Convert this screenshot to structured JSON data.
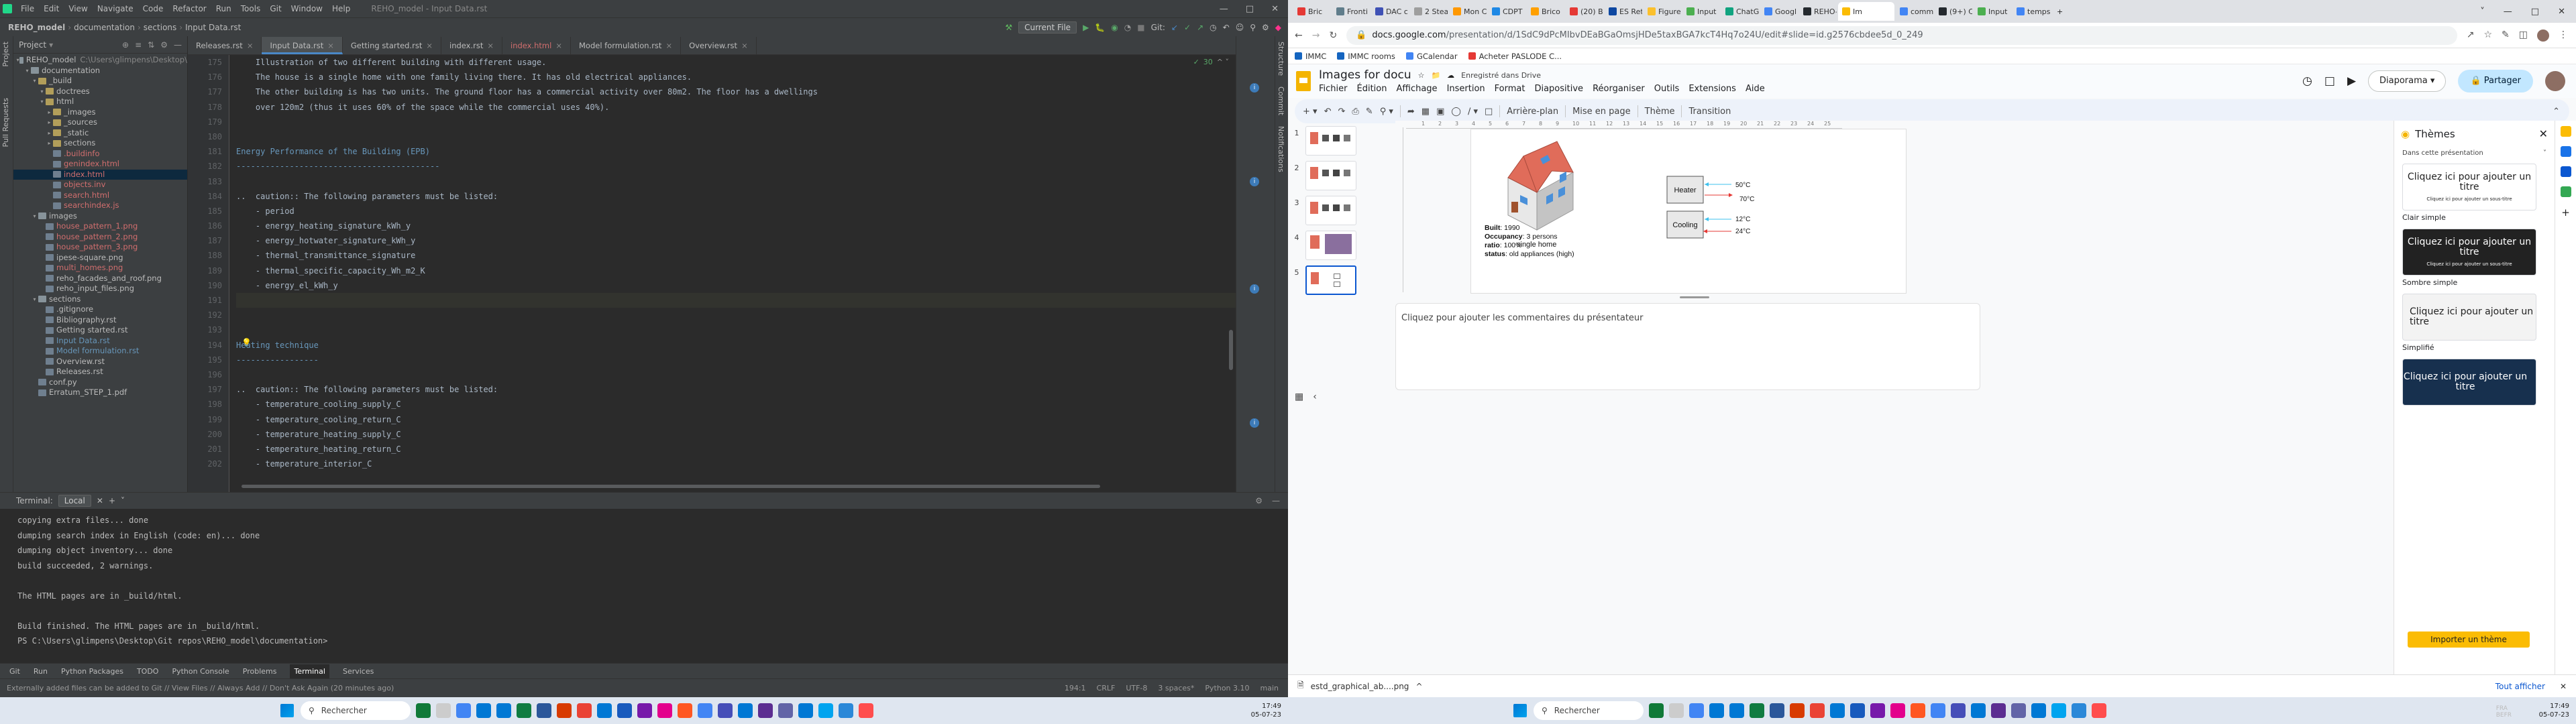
{
  "ide": {
    "app_icon": "pycharm-icon",
    "menus": [
      "File",
      "Edit",
      "View",
      "Navigate",
      "Code",
      "Refactor",
      "Run",
      "Tools",
      "Git",
      "Window",
      "Help"
    ],
    "window_title": "REHO_model - Input Data.rst",
    "breadcrumbs": [
      "REHO_model",
      "documentation",
      "sections",
      "Input Data.rst"
    ],
    "run_config": "Current File",
    "git_label": "Git:",
    "project_label": "Project",
    "tree": [
      {
        "label": "REHO_model",
        "suffix": "C:\\Users\\glimpens\\Desktop\\",
        "depth": 0,
        "type": "folder",
        "color": "grey"
      },
      {
        "label": "documentation",
        "depth": 1,
        "type": "folder",
        "color": "grey"
      },
      {
        "label": "_build",
        "depth": 2,
        "type": "folder-y",
        "color": "grey"
      },
      {
        "label": "doctrees",
        "depth": 3,
        "type": "folder-y",
        "color": "grey"
      },
      {
        "label": "html",
        "depth": 3,
        "type": "folder-y",
        "color": "grey"
      },
      {
        "label": "_images",
        "depth": 4,
        "type": "folder-y",
        "color": "grey"
      },
      {
        "label": "_sources",
        "depth": 4,
        "type": "folder-y",
        "color": "grey"
      },
      {
        "label": "_static",
        "depth": 4,
        "type": "folder-y",
        "color": "grey"
      },
      {
        "label": "sections",
        "depth": 4,
        "type": "folder-y",
        "color": "grey"
      },
      {
        "label": ".buildinfo",
        "depth": 4,
        "type": "file",
        "color": "red"
      },
      {
        "label": "genindex.html",
        "depth": 4,
        "type": "file",
        "color": "red"
      },
      {
        "label": "index.html",
        "depth": 4,
        "type": "file",
        "color": "red",
        "selected": true
      },
      {
        "label": "objects.inv",
        "depth": 4,
        "type": "file",
        "color": "red"
      },
      {
        "label": "search.html",
        "depth": 4,
        "type": "file",
        "color": "red"
      },
      {
        "label": "searchindex.js",
        "depth": 4,
        "type": "file",
        "color": "red"
      },
      {
        "label": "images",
        "depth": 2,
        "type": "folder",
        "color": "grey"
      },
      {
        "label": "house_pattern_1.png",
        "depth": 3,
        "type": "file",
        "color": "red"
      },
      {
        "label": "house_pattern_2.png",
        "depth": 3,
        "type": "file",
        "color": "red"
      },
      {
        "label": "house_pattern_3.png",
        "depth": 3,
        "type": "file",
        "color": "red"
      },
      {
        "label": "ipese-square.png",
        "depth": 3,
        "type": "file",
        "color": "grey"
      },
      {
        "label": "multi_homes.png",
        "depth": 3,
        "type": "file",
        "color": "red"
      },
      {
        "label": "reho_facades_and_roof.png",
        "depth": 3,
        "type": "file",
        "color": "grey"
      },
      {
        "label": "reho_input_files.png",
        "depth": 3,
        "type": "file",
        "color": "grey"
      },
      {
        "label": "sections",
        "depth": 2,
        "type": "folder",
        "color": "grey"
      },
      {
        "label": ".gitignore",
        "depth": 3,
        "type": "file",
        "color": "grey"
      },
      {
        "label": "Bibliography.rst",
        "depth": 3,
        "type": "file",
        "color": "grey"
      },
      {
        "label": "Getting started.rst",
        "depth": 3,
        "type": "file",
        "color": "grey"
      },
      {
        "label": "Input Data.rst",
        "depth": 3,
        "type": "file",
        "color": "blue"
      },
      {
        "label": "Model formulation.rst",
        "depth": 3,
        "type": "file",
        "color": "blue"
      },
      {
        "label": "Overview.rst",
        "depth": 3,
        "type": "file",
        "color": "grey"
      },
      {
        "label": "Releases.rst",
        "depth": 3,
        "type": "file",
        "color": "grey"
      },
      {
        "label": "conf.py",
        "depth": 2,
        "type": "file",
        "color": "grey"
      },
      {
        "label": "Erratum_STEP_1.pdf",
        "depth": 2,
        "type": "file",
        "color": "grey"
      }
    ],
    "tabs": [
      {
        "label": "Releases.rst",
        "color": "grey"
      },
      {
        "label": "Input Data.rst",
        "color": "grey",
        "active": true
      },
      {
        "label": "Getting started.rst",
        "color": "grey"
      },
      {
        "label": "index.rst",
        "color": "grey"
      },
      {
        "label": "index.html",
        "color": "red"
      },
      {
        "label": "Model formulation.rst",
        "color": "grey"
      },
      {
        "label": "Overview.rst",
        "color": "grey"
      }
    ],
    "inspection_count": "30",
    "code_lines": [
      {
        "n": "175",
        "t": "    Illustration of two different building with different usage."
      },
      {
        "n": "176",
        "t": "    The house is a single home with one family living there. It has old electrical appliances."
      },
      {
        "n": "177",
        "t": "    The other building is has two units. The ground floor has a commercial activity over 80m2. The floor has a dwellings"
      },
      {
        "n": "178",
        "t": "    over 120m2 (thus it uses 60% of the space while the commercial uses 40%)."
      },
      {
        "n": "179",
        "t": ""
      },
      {
        "n": "180",
        "t": ""
      },
      {
        "n": "181",
        "t": "Energy Performance of the Building (EPB)",
        "cls": "h"
      },
      {
        "n": "182",
        "t": "------------------------------------------",
        "cls": "h"
      },
      {
        "n": "183",
        "t": ""
      },
      {
        "n": "184",
        "t": "..  caution:: The following parameters must be listed:"
      },
      {
        "n": "185",
        "t": "    - period"
      },
      {
        "n": "186",
        "t": "    - energy_heating_signature_kWh_y"
      },
      {
        "n": "187",
        "t": "    - energy_hotwater_signature_kWh_y"
      },
      {
        "n": "188",
        "t": "    - thermal_transmittance_signature"
      },
      {
        "n": "189",
        "t": "    - thermal_specific_capacity_Wh_m2_K"
      },
      {
        "n": "190",
        "t": "    - energy_el_kWh_y"
      },
      {
        "n": "191",
        "t": "",
        "cls": "cur"
      },
      {
        "n": "192",
        "t": ""
      },
      {
        "n": "193",
        "t": ""
      },
      {
        "n": "194",
        "t": "Heating technique",
        "cls": "h"
      },
      {
        "n": "195",
        "t": "-----------------",
        "cls": "h"
      },
      {
        "n": "196",
        "t": ""
      },
      {
        "n": "197",
        "t": "..  caution:: The following parameters must be listed:"
      },
      {
        "n": "198",
        "t": "    - temperature_cooling_supply_C"
      },
      {
        "n": "199",
        "t": "    - temperature_cooling_return_C"
      },
      {
        "n": "200",
        "t": "    - temperature_heating_supply_C"
      },
      {
        "n": "201",
        "t": "    - temperature_heating_return_C"
      },
      {
        "n": "202",
        "t": "    - temperature_interior_C"
      }
    ],
    "right_tools": [
      "Structure",
      "Commit",
      "Notifications"
    ],
    "left_tools": [
      "Project",
      "Pull Requests"
    ],
    "terminal_label": "Terminal:",
    "terminal_tab": "Local",
    "terminal_lines": [
      "copying extra files... done",
      "dumping search index in English (code: en)... done",
      "dumping object inventory... done",
      "build succeeded, 2 warnings.",
      "",
      "The HTML pages are in _build/html.",
      "",
      "Build finished. The HTML pages are in _build/html.",
      "PS C:\\Users\\glimpens\\Desktop\\Git repos\\REHO_model\\documentation> "
    ],
    "bottom_tabs": [
      "Git",
      "Run",
      "Python Packages",
      "TODO",
      "Python Console",
      "Problems",
      "Terminal",
      "Services"
    ],
    "status_left": "Externally added files can be added to Git // View Files // Always Add // Don't Ask Again (20 minutes ago)",
    "status_right": [
      "194:1",
      "CRLF",
      "UTF-8",
      "3 spaces*",
      "Python 3.10",
      "main"
    ]
  },
  "chrome": {
    "tabs": [
      "Bric",
      "Fronti",
      "DAC c",
      "2 Stea",
      "Mon C",
      "CDPT",
      "Brico",
      "(20) B",
      "ES Ret",
      "Figure",
      "Input",
      "ChatG",
      "Googl",
      "REHO-",
      "Im",
      "comm",
      "(9+) C",
      "Input",
      "temps"
    ],
    "active_tab_index": 14,
    "url_host": "docs.google.com",
    "url_path": "/presentation/d/1SdC9dPcMIbvDEaBGaOmsjHDe5taxBGA7kcT4Hq7o24U/edit#slide=id.g2576cbdee5d_0_249",
    "bookmarks": [
      "IMMC",
      "IMMC rooms",
      "GCalendar",
      "Acheter PASLODE C..."
    ]
  },
  "slides": {
    "doc_title": "Images for docu",
    "saved_status": "Enregistré dans Drive",
    "menus": [
      "Fichier",
      "Édition",
      "Affichage",
      "Insertion",
      "Format",
      "Diapositive",
      "Réorganiser",
      "Outils",
      "Extensions",
      "Aide"
    ],
    "present_label": "Diaporama",
    "share_label": "Partager",
    "toolbar_items": [
      "Arrière-plan",
      "Mise en page",
      "Thème",
      "Transition"
    ],
    "slide_numbers": [
      "1",
      "2",
      "3",
      "4",
      "5"
    ],
    "selected_slide": 5,
    "slide": {
      "house_caption": "single home",
      "info": [
        {
          "k": "Built",
          "v": ": 1990"
        },
        {
          "k": "Occupancy",
          "v": ": 3 persons"
        },
        {
          "k": "ratio",
          "v": ": 100%"
        },
        {
          "k": "status",
          "v": ": old appliances (high)"
        }
      ],
      "heater_label": "Heater",
      "heater_in": "50°C",
      "heater_out": "70°C",
      "cooling_label": "Cooling",
      "cooling_in": "12°C",
      "cooling_out": "24°C",
      "colors": {
        "roof": "#e06c5a",
        "wall_light": "#e8e8e8",
        "wall_dark": "#c4c4c4",
        "window": "#4a90d9",
        "door": "#a0522d",
        "arrow_blue": "#3ec1ee",
        "arrow_red": "#e53935"
      }
    },
    "notes_placeholder": "Cliquez pour ajouter les commentaires du présentateur",
    "themes": {
      "title": "Thèmes",
      "dropdown": "Dans cette présentation",
      "cards": [
        {
          "name": "Clair simple",
          "title": "Cliquez ici pour ajouter un titre",
          "sub": "Cliquez ici pour ajouter un sous-titre",
          "style": "light"
        },
        {
          "name": "Sombre simple",
          "title": "Cliquez ici pour ajouter un titre",
          "sub": "Cliquez ici pour ajouter un sous-titre",
          "style": "dark"
        },
        {
          "name": "Simplifié",
          "title": "Cliquez ici pour ajouter un titre",
          "sub": "",
          "style": "simple"
        },
        {
          "name": "",
          "title": "Cliquez ici pour ajouter un titre",
          "sub": "",
          "style": "navy"
        }
      ],
      "import_label": "Importer un thème"
    }
  },
  "download": {
    "file": "estd_graphical_ab....png",
    "show_all": "Tout afficher"
  },
  "taskbar": {
    "search_placeholder": "Rechercher",
    "time": "17:49",
    "date": "05-07-23",
    "lang_left": "",
    "lang_right": "FRA\nBEFR"
  }
}
